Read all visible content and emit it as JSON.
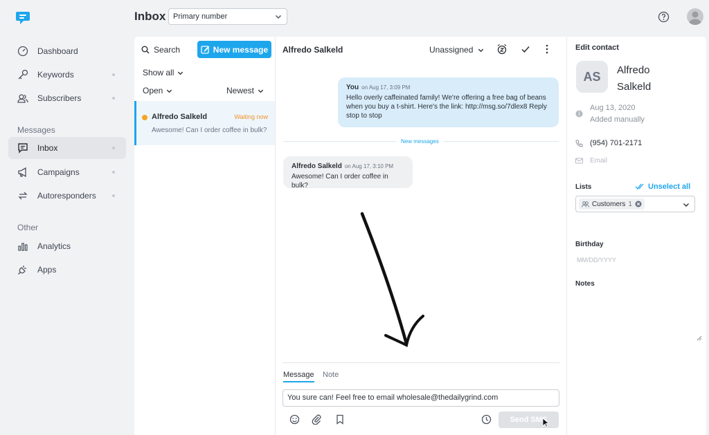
{
  "nav": {
    "items": [
      {
        "label": "Dashboard"
      },
      {
        "label": "Keywords"
      },
      {
        "label": "Subscribers"
      }
    ],
    "section_messages": "Messages",
    "message_items": [
      {
        "label": "Inbox"
      },
      {
        "label": "Campaigns"
      },
      {
        "label": "Autoresponders"
      }
    ],
    "section_other": "Other",
    "other_items": [
      {
        "label": "Analytics"
      },
      {
        "label": "Apps"
      }
    ]
  },
  "header": {
    "title": "Inbox",
    "number_select": "Primary number"
  },
  "list": {
    "search_label": "Search",
    "new_message_label": "New message",
    "filter_show": "Show all",
    "filter_status": "Open",
    "filter_sort": "Newest",
    "conversations": [
      {
        "name": "Alfredo Salkeld",
        "status": "Waiting now",
        "preview": "Awesome! Can I order coffee in bulk?"
      }
    ]
  },
  "conversation": {
    "contact": "Alfredo Salkeld",
    "assignee": "Unassigned",
    "messages": [
      {
        "who": "You",
        "when": "on Aug 17, 3:09 PM",
        "text": "Hello overly caffeinated family! We're offering a free bag of beans when you buy a t-shirt. Here's the link: http://msg.so/7dlex8 Reply stop to stop"
      },
      {
        "who": "Alfredo Salkeld",
        "when": "on Aug 17, 3:10 PM",
        "text": "Awesome! Can I order coffee in bulk?"
      }
    ],
    "separator_label": "New messages",
    "tab_message": "Message",
    "tab_note": "Note",
    "compose_value": "You sure can! Feel free to email wholesale@thedailygrind.com",
    "send_label": "Send SMS"
  },
  "contact": {
    "panel_title": "Edit contact",
    "initials": "AS",
    "name": "Alfredo Salkeld",
    "added_date": "Aug 13, 2020",
    "added_method": "Added manually",
    "phone": "(954) 701-2171",
    "email_placeholder": "Email",
    "lists_label": "Lists",
    "unselect_all": "Unselect all",
    "list_chip": "Customers",
    "list_chip_count": "1",
    "birthday_label": "Birthday",
    "birthday_placeholder": "MM/DD/YYYY",
    "notes_label": "Notes"
  },
  "colors": {
    "accent": "#1ea6ec",
    "waiting": "#f0932b",
    "outgoing_bubble": "#d8ecfa",
    "incoming_bubble": "#eef0f2"
  }
}
